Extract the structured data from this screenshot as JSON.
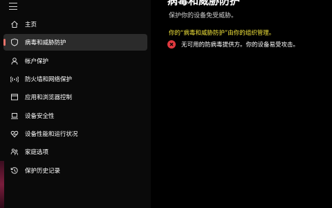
{
  "header": {
    "title": "病毒和威胁防护",
    "subtitle": "保护你的设备免受威胁。"
  },
  "notice": {
    "managed_text": "你的“病毒和威胁防护”由你的组织管理。",
    "error_text": "无可用的防病毒提供方。你的设备易受攻击。"
  },
  "sidebar": {
    "items": [
      {
        "label": "主页",
        "icon": "home-icon"
      },
      {
        "label": "病毒和威胁防护",
        "icon": "shield-icon",
        "active": true
      },
      {
        "label": "帐户保护",
        "icon": "person-icon"
      },
      {
        "label": "防火墙和网络保护",
        "icon": "wifi-icon"
      },
      {
        "label": "应用和浏览器控制",
        "icon": "app-window-icon"
      },
      {
        "label": "设备安全性",
        "icon": "laptop-icon"
      },
      {
        "label": "设备性能和运行状况",
        "icon": "heart-icon"
      },
      {
        "label": "家庭选项",
        "icon": "family-icon"
      },
      {
        "label": "保护历史记录",
        "icon": "history-icon"
      }
    ]
  },
  "colors": {
    "accent": "#e8736b",
    "warning_text": "#f0e23a",
    "error": "#e0393f"
  }
}
